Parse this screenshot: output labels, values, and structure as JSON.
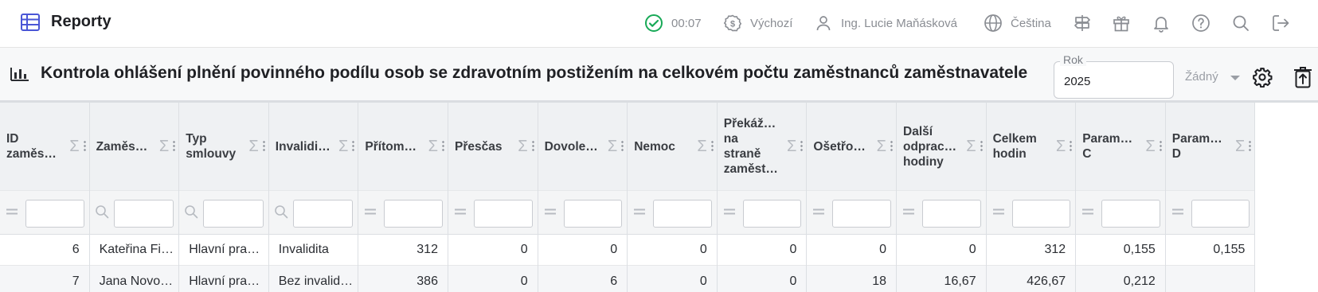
{
  "app": {
    "title": "Reporty",
    "icon": "table-icon"
  },
  "topbar": {
    "timer": "00:07",
    "currency": "Výchozí",
    "user": "Ing. Lucie Maňásková",
    "language": "Čeština"
  },
  "report": {
    "title": "Kontrola ohlášení plnění povinného podílu osob se zdravotním postižením na celkovém počtu zaměstnanců zaměstnavatele",
    "year_label": "Rok",
    "year_value": "2025",
    "variant": "Žádný"
  },
  "grid": {
    "sum_symbol": "Σ",
    "columns": [
      {
        "header": "ID zaměs…",
        "filter": "equals"
      },
      {
        "header": "Zaměs…",
        "filter": "search"
      },
      {
        "header": "Typ smlouvy",
        "filter": "search"
      },
      {
        "header": "Invalidi…",
        "filter": "search"
      },
      {
        "header": "Přítom…",
        "filter": "equals"
      },
      {
        "header": "Přesčas",
        "filter": "equals"
      },
      {
        "header": "Dovole…",
        "filter": "equals"
      },
      {
        "header": "Nemoc",
        "filter": "equals"
      },
      {
        "header": "Překáž… na straně zaměst…",
        "filter": "equals"
      },
      {
        "header": "Ošetřo…",
        "filter": "equals"
      },
      {
        "header": "Další odprac… hodiny",
        "filter": "equals"
      },
      {
        "header": "Celkem hodin",
        "filter": "equals"
      },
      {
        "header": "Param… C",
        "filter": "equals"
      },
      {
        "header": "Param… D",
        "filter": "equals"
      }
    ],
    "rows": [
      [
        "6",
        "Kateřina Fi…",
        "Hlavní pra…",
        "Invalidita",
        "312",
        "0",
        "0",
        "0",
        "0",
        "0",
        "0",
        "312",
        "0,155",
        "0,155"
      ],
      [
        "7",
        "Jana Novo…",
        "Hlavní pra…",
        "Bez invalid…",
        "386",
        "0",
        "6",
        "0",
        "0",
        "18",
        "16,67",
        "426,67",
        "0,212",
        ""
      ]
    ]
  }
}
